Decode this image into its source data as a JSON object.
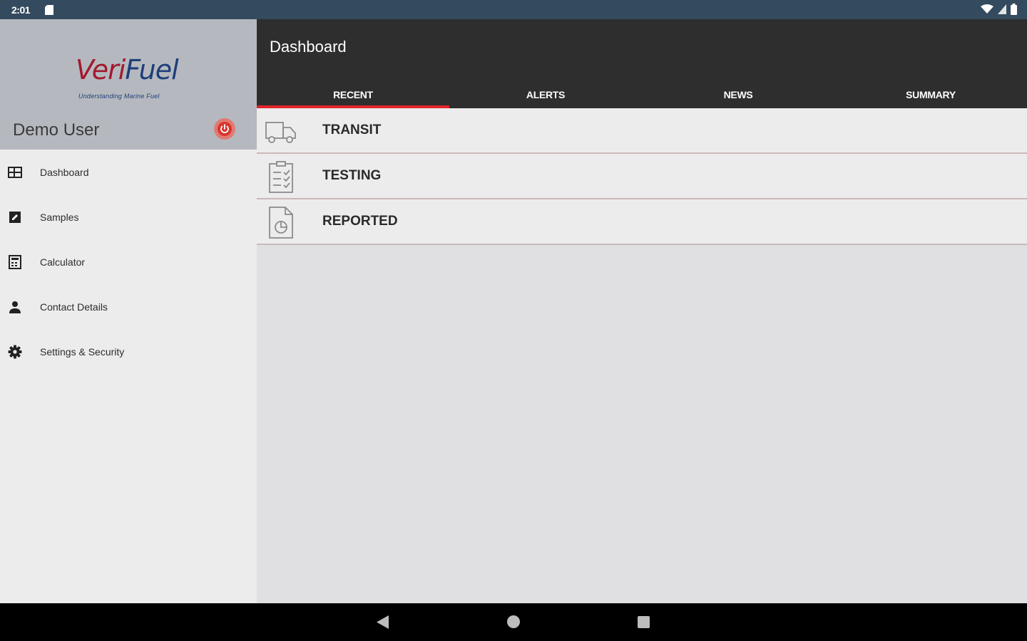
{
  "status_bar": {
    "time": "2:01"
  },
  "drawer": {
    "logo": {
      "brand_part1": "Veri",
      "brand_part2": "Fuel",
      "tagline": "Understanding Marine Fuel"
    },
    "user_name": "Demo User",
    "items": [
      {
        "label": "Dashboard",
        "icon": "dashboard-icon"
      },
      {
        "label": "Samples",
        "icon": "edit-icon"
      },
      {
        "label": "Calculator",
        "icon": "calculator-icon"
      },
      {
        "label": "Contact Details",
        "icon": "person-icon"
      },
      {
        "label": "Settings & Security",
        "icon": "gear-icon"
      }
    ]
  },
  "app_bar": {
    "title": "Dashboard",
    "tabs": [
      {
        "label": "RECENT",
        "active": true
      },
      {
        "label": "ALERTS",
        "active": false
      },
      {
        "label": "NEWS",
        "active": false
      },
      {
        "label": "SUMMARY",
        "active": false
      }
    ]
  },
  "main": {
    "rows": [
      {
        "label": "TRANSIT",
        "icon": "truck-icon"
      },
      {
        "label": "TESTING",
        "icon": "checklist-icon"
      },
      {
        "label": "REPORTED",
        "icon": "report-document-icon"
      }
    ]
  },
  "colors": {
    "accent": "#e2252a",
    "status_bar": "#344a5e",
    "app_bar": "#2e2e2e",
    "drawer_header": "#b5b9bf"
  }
}
